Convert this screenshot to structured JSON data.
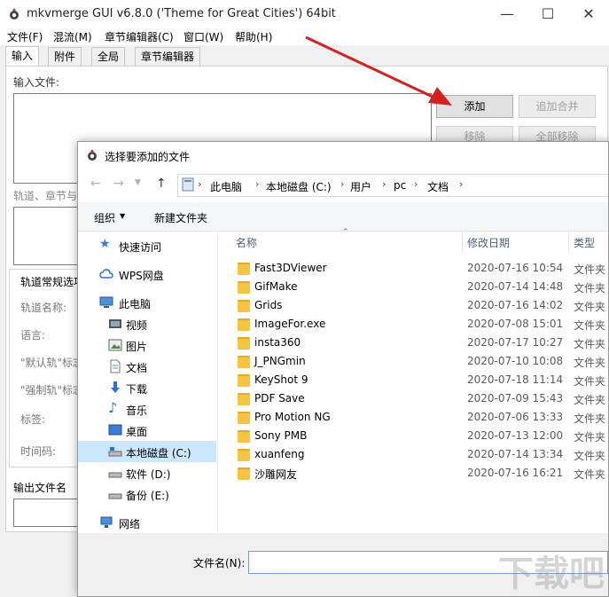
{
  "main": {
    "title": "mkvmerge GUI v6.8.0 ('Theme for Great Cities') 64bit",
    "menu": [
      "文件(F)",
      "混流(M)",
      "章节编辑器(C)",
      "窗口(W)",
      "帮助(H)"
    ],
    "tabs": [
      "输入",
      "附件",
      "全局",
      "章节编辑器"
    ],
    "input_files_label": "输入文件:",
    "add_button": "添加",
    "append_button": "追加合并",
    "remove_button": "移除",
    "remove_all_button": "全部移除",
    "tracks_label": "轨道、章节与",
    "track_options_label": "轨道常规选项",
    "track_name_label": "轨道名称:",
    "language_label": "语言:",
    "default_track_label": "\"默认轨\"标志",
    "forced_track_label": "\"强制轨\"标志",
    "tags_label": "标签:",
    "timecode_label": "时间码:",
    "output_label": "输出文件名"
  },
  "dialog": {
    "title": "选择要添加的文件",
    "breadcrumb": [
      "此电脑",
      "本地磁盘 (C:)",
      "用户",
      "pc",
      "文档"
    ],
    "organize": "组织",
    "new_folder": "新建文件夹",
    "nav": [
      {
        "label": "快速访问",
        "icon": "star-icon"
      },
      {
        "label": "WPS网盘",
        "icon": "cloud-icon"
      },
      {
        "label": "此电脑",
        "icon": "computer-icon"
      },
      {
        "label": "视频",
        "icon": "video-icon"
      },
      {
        "label": "图片",
        "icon": "picture-icon"
      },
      {
        "label": "文档",
        "icon": "document-icon"
      },
      {
        "label": "下载",
        "icon": "download-icon"
      },
      {
        "label": "音乐",
        "icon": "music-icon"
      },
      {
        "label": "桌面",
        "icon": "desktop-icon"
      },
      {
        "label": "本地磁盘 (C:)",
        "icon": "drive-icon"
      },
      {
        "label": "软件 (D:)",
        "icon": "drive-icon"
      },
      {
        "label": "备份 (E:)",
        "icon": "drive-icon"
      },
      {
        "label": "网络",
        "icon": "network-icon"
      }
    ],
    "columns": {
      "name": "名称",
      "date": "修改日期",
      "type": "类型"
    },
    "files": [
      {
        "name": "Fast3DViewer",
        "date": "2020-07-16 10:54",
        "type": "文件夹"
      },
      {
        "name": "GifMake",
        "date": "2020-07-14 14:48",
        "type": "文件夹"
      },
      {
        "name": "Grids",
        "date": "2020-07-16 14:02",
        "type": "文件夹"
      },
      {
        "name": "ImageFor.exe",
        "date": "2020-07-08 15:01",
        "type": "文件夹"
      },
      {
        "name": "insta360",
        "date": "2020-07-17 10:27",
        "type": "文件夹"
      },
      {
        "name": "J_PNGmin",
        "date": "2020-07-10 10:08",
        "type": "文件夹"
      },
      {
        "name": "KeyShot 9",
        "date": "2020-07-18 11:14",
        "type": "文件夹"
      },
      {
        "name": "PDF Save",
        "date": "2020-07-09 15:43",
        "type": "文件夹"
      },
      {
        "name": "Pro Motion NG",
        "date": "2020-07-06 13:33",
        "type": "文件夹"
      },
      {
        "name": "Sony PMB",
        "date": "2020-07-13 12:00",
        "type": "文件夹"
      },
      {
        "name": "xuanfeng",
        "date": "2020-07-14 13:34",
        "type": "文件夹"
      },
      {
        "name": "沙雕网友",
        "date": "2020-07-16 16:21",
        "type": "文件夹"
      }
    ],
    "filename_label": "文件名(N):",
    "filename_value": ""
  },
  "colors": {
    "arrow": "#d42020",
    "selection": "#cce8ff",
    "folder": "#f5c542"
  }
}
